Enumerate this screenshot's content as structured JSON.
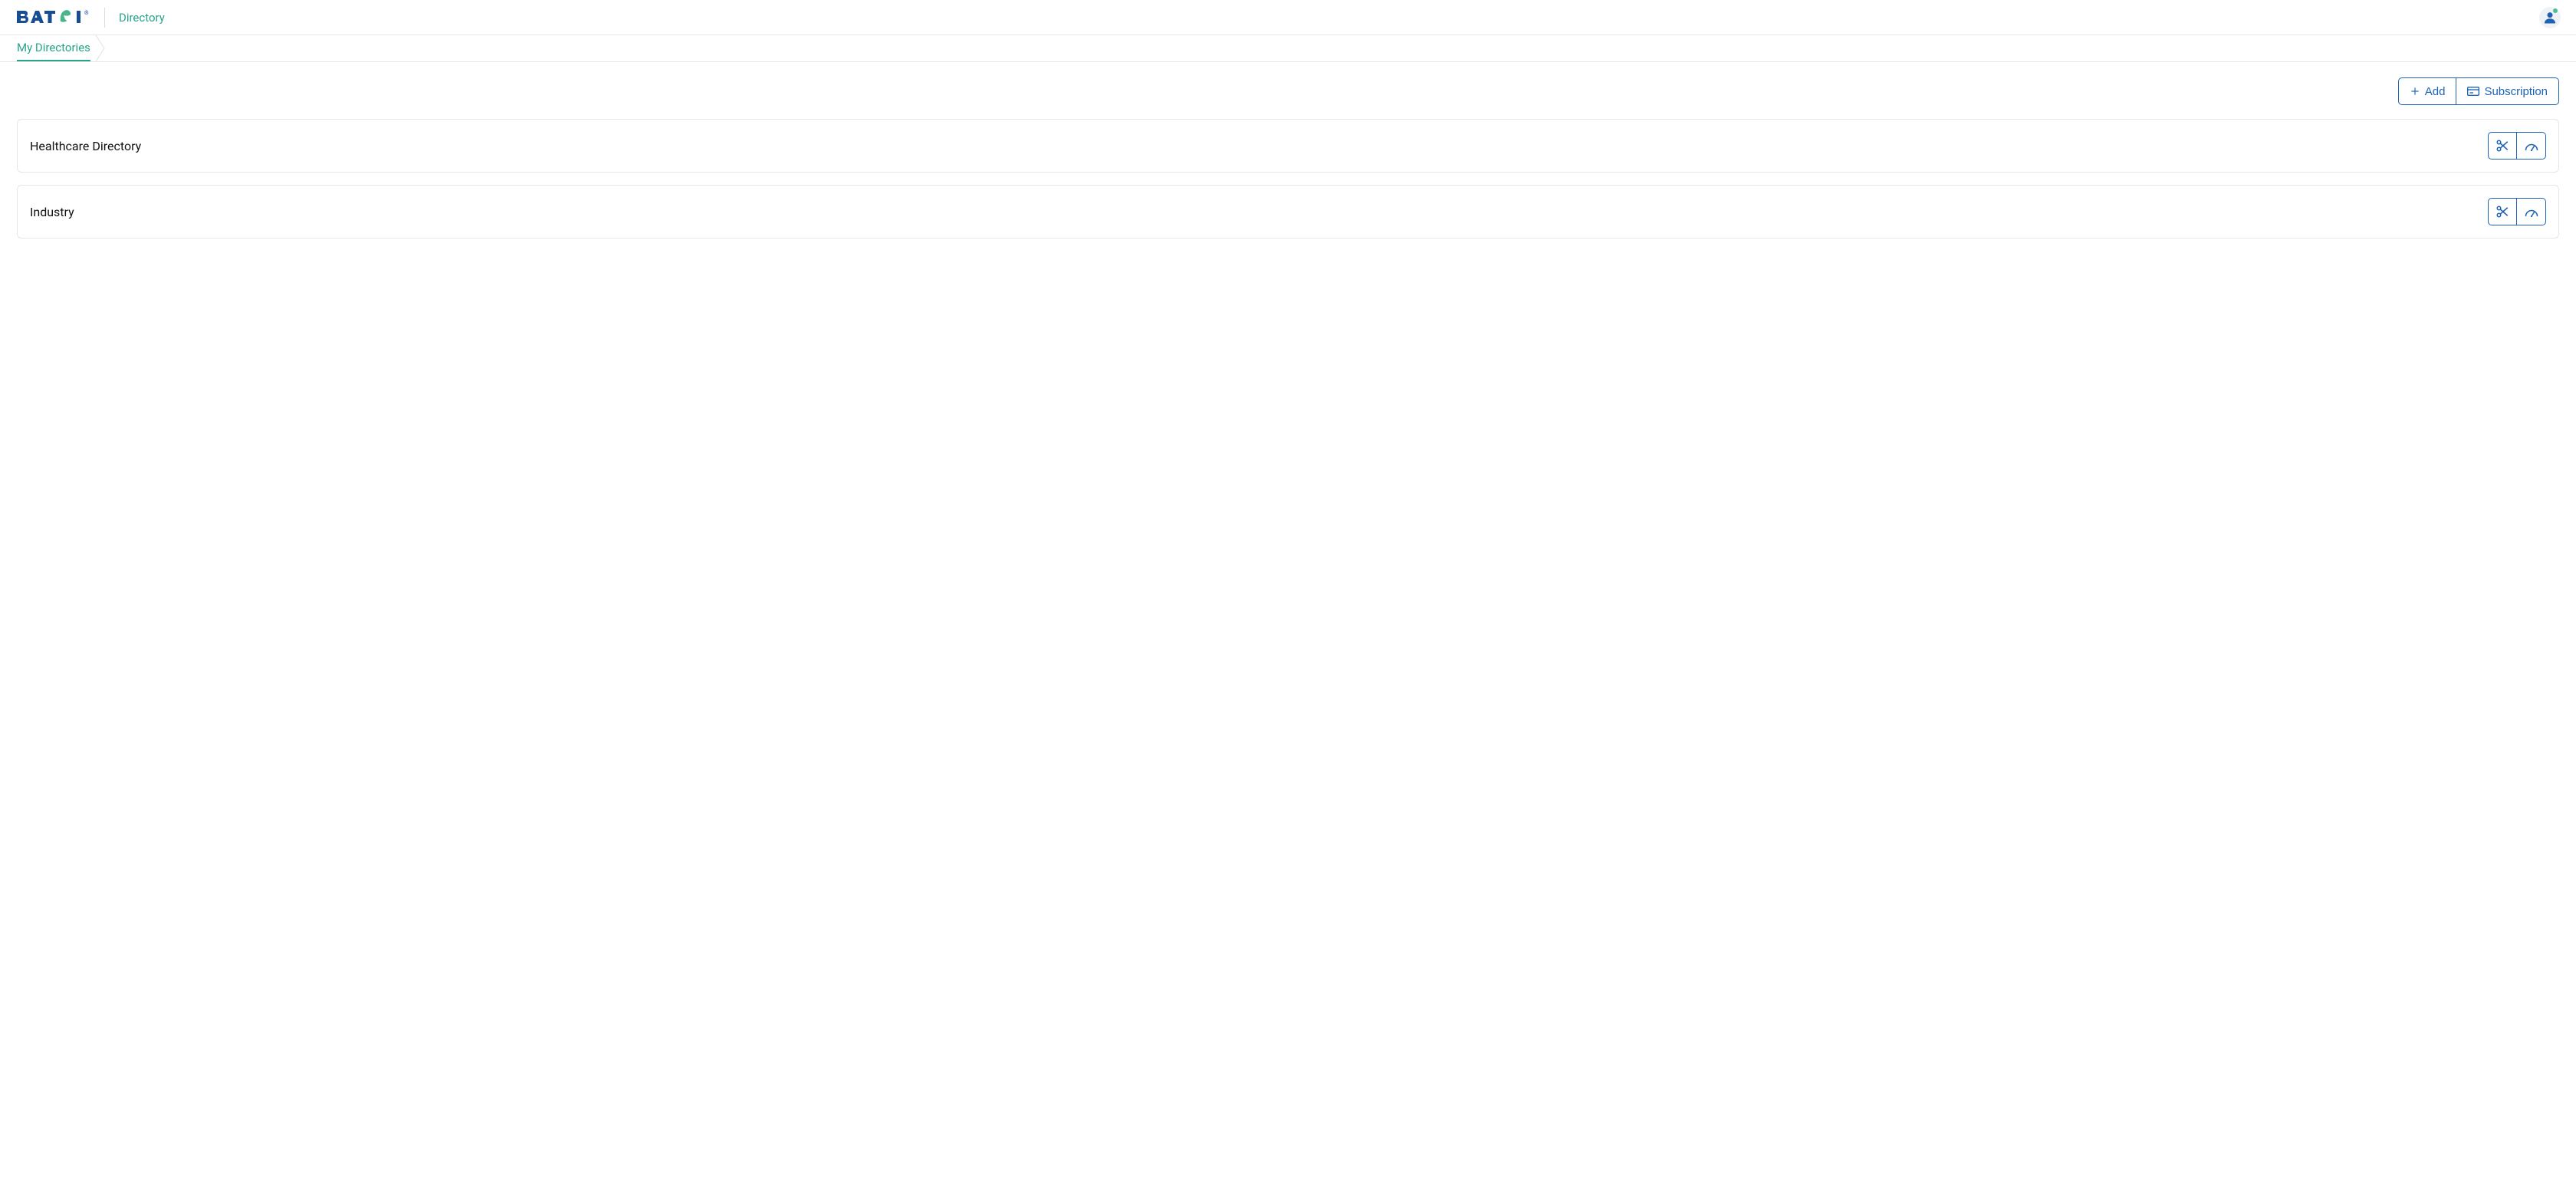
{
  "header": {
    "logo_text": "BATOI",
    "app_name": "Directory"
  },
  "breadcrumb": {
    "items": [
      {
        "label": "My Directories",
        "active": true
      }
    ]
  },
  "actions": {
    "add_label": "Add",
    "subscription_label": "Subscription"
  },
  "directories": [
    {
      "name": "Healthcare Directory"
    },
    {
      "name": "Industry"
    }
  ],
  "colors": {
    "primary": "#1e62b4",
    "accent": "#28a48b",
    "border": "#e6e6e6"
  }
}
